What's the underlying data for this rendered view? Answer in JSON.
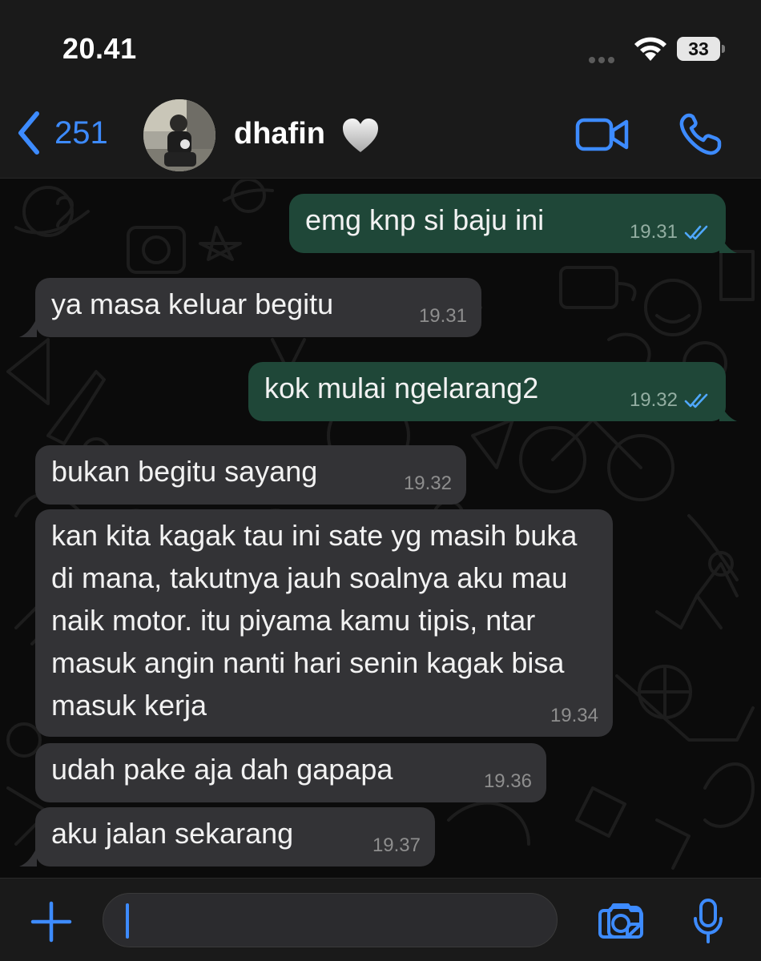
{
  "status_bar": {
    "time": "20.41",
    "battery": "33"
  },
  "header": {
    "back_count": "251",
    "contact_name": "dhafin",
    "contact_emoji": "white-heart",
    "icons": {
      "back": "chevron-left-icon",
      "video": "video-camera-icon",
      "call": "phone-icon"
    }
  },
  "messages": [
    {
      "direction": "outgoing",
      "text": "emg knp si baju ini",
      "time": "19.31",
      "status": "read"
    },
    {
      "direction": "incoming",
      "text": "ya masa keluar begitu",
      "time": "19.31"
    },
    {
      "direction": "outgoing",
      "text": "kok mulai ngelarang2",
      "time": "19.32",
      "status": "read"
    },
    {
      "direction": "incoming",
      "text": "bukan begitu sayang",
      "time": "19.32"
    },
    {
      "direction": "incoming",
      "text": "kan kita kagak tau ini sate yg masih buka di mana, takutnya jauh soalnya aku mau naik motor. itu piyama kamu tipis, ntar masuk angin nanti hari senin kagak bisa masuk kerja",
      "time": "19.34"
    },
    {
      "direction": "incoming",
      "text": "udah pake aja dah gapapa",
      "time": "19.36"
    },
    {
      "direction": "incoming",
      "text": "aku jalan sekarang",
      "time": "19.37"
    }
  ],
  "input": {
    "value": "",
    "icons": [
      "plus-icon",
      "sticker-icon",
      "camera-icon",
      "microphone-icon"
    ]
  },
  "colors": {
    "accent": "#3d8bff",
    "outgoing_bubble": "#1f4738",
    "incoming_bubble": "#333336",
    "background": "#0b0b0b"
  }
}
